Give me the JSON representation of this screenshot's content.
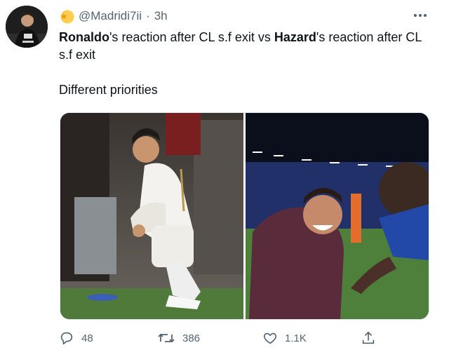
{
  "tweet": {
    "handle": "@Madridi7ii",
    "separator": "·",
    "time": "3h",
    "more_icon": "more-horizontal-icon",
    "text": {
      "bold1": "Ronaldo",
      "part1": "'s reaction after CL s.f exit vs ",
      "bold2": "Hazard",
      "part2": "'s reaction after CL s.f exit",
      "line3": "Different priorities"
    },
    "actions": {
      "reply_count": "48",
      "retweet_count": "386",
      "like_count": "1.1K"
    }
  },
  "colors": {
    "muted": "#536471",
    "text": "#0f1419"
  }
}
